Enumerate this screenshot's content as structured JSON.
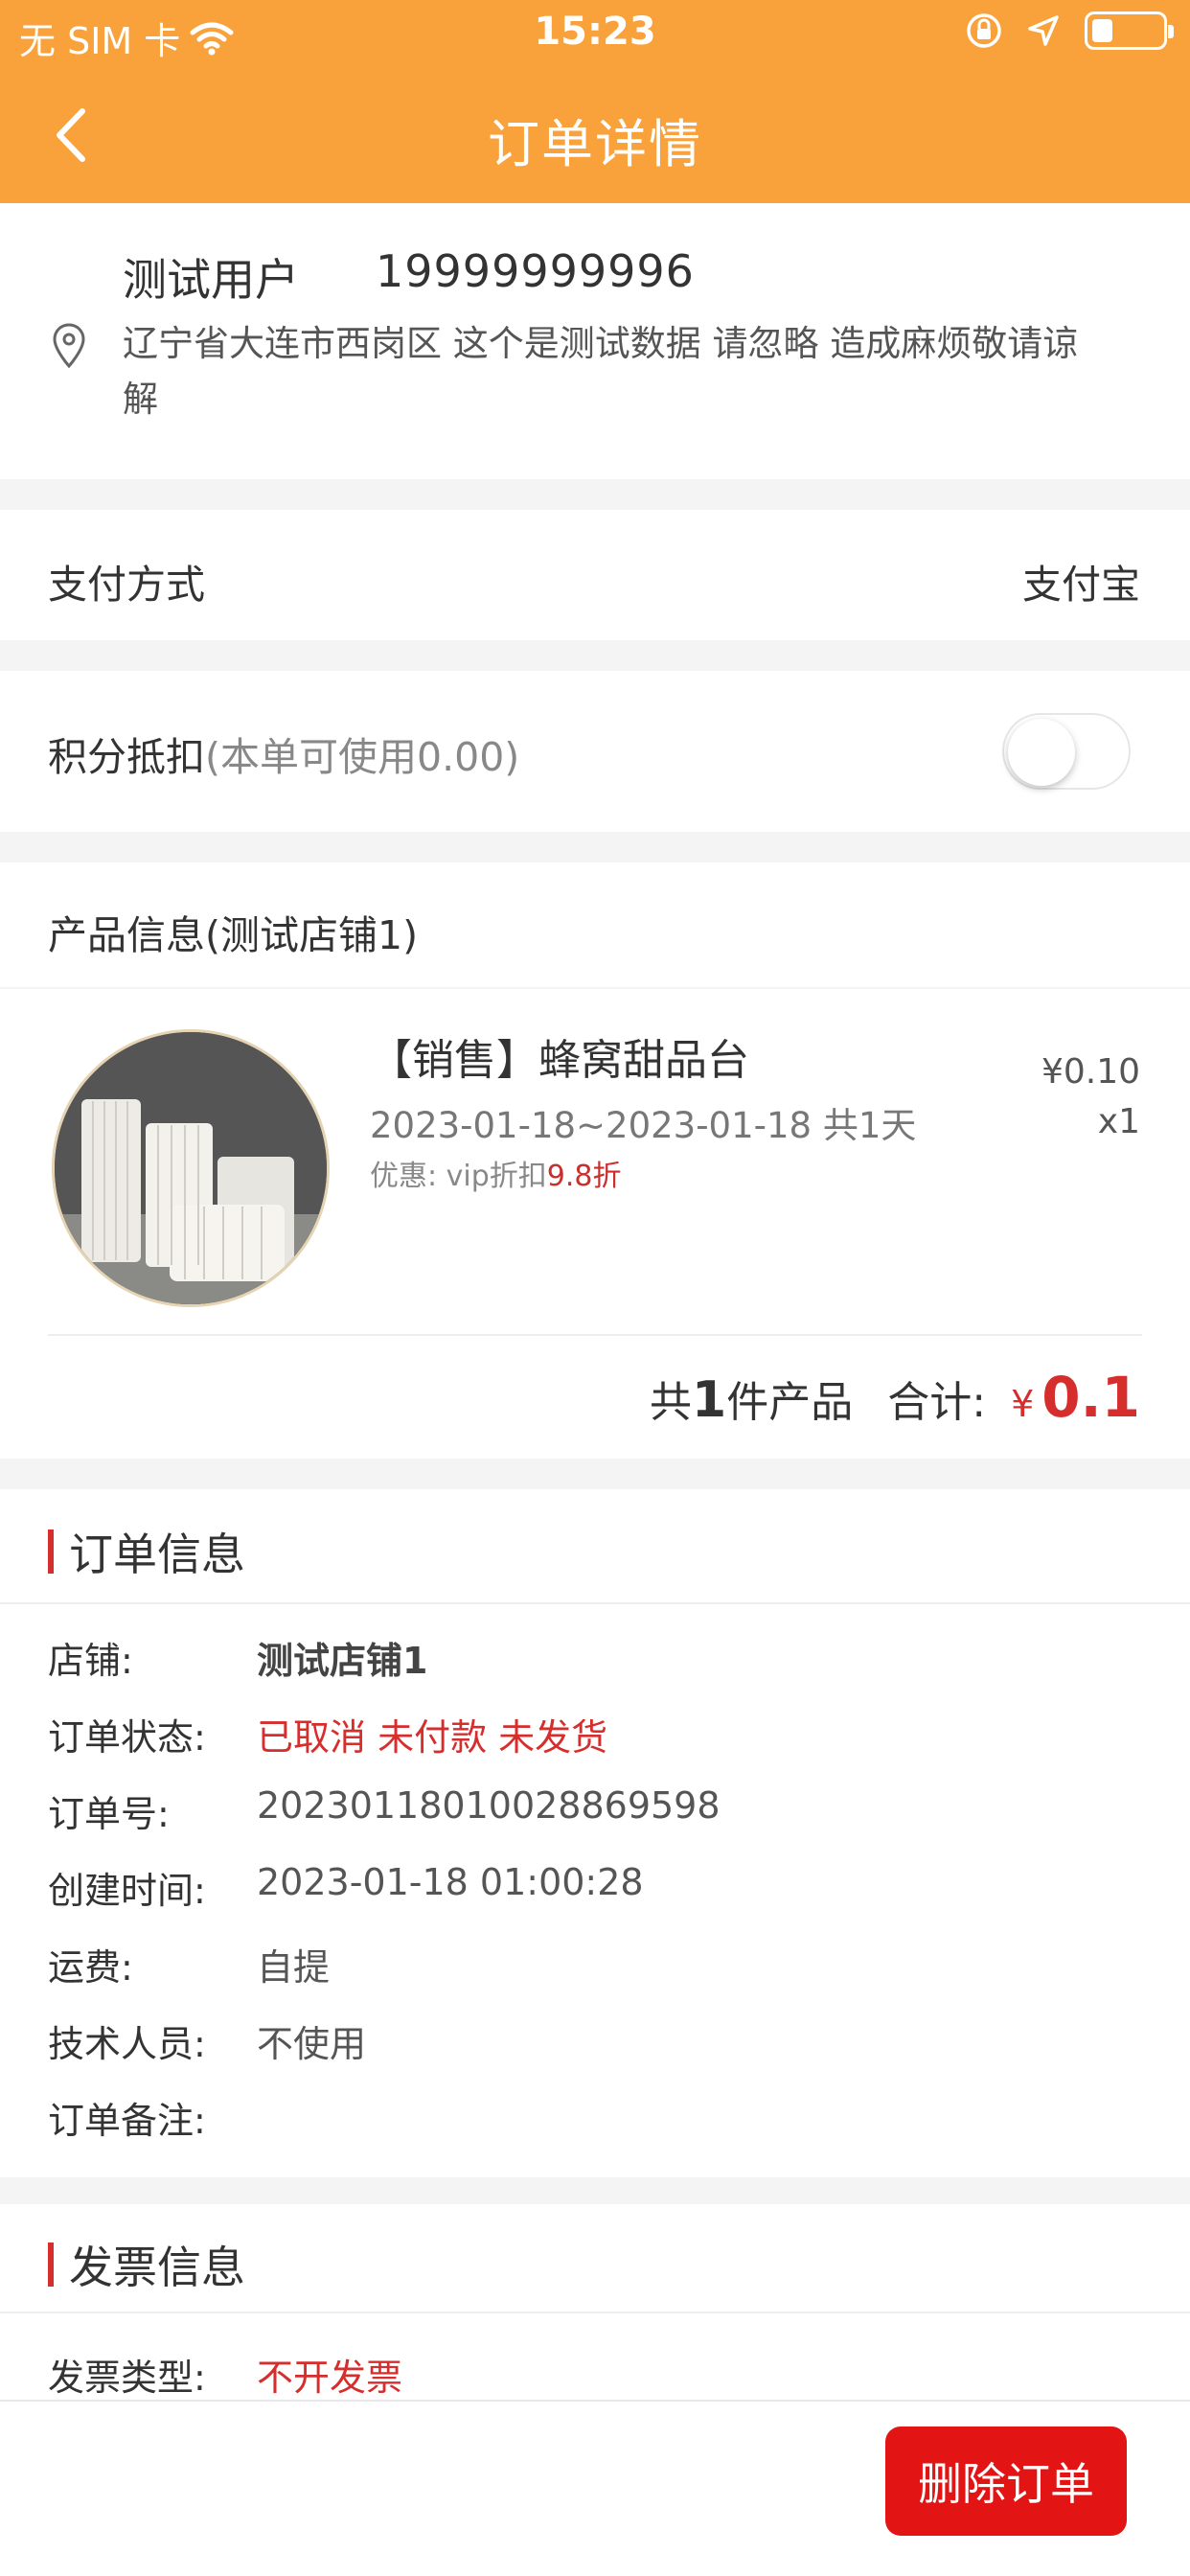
{
  "status_bar": {
    "carrier": "无 SIM 卡",
    "time": "15:23",
    "icons": [
      "wifi-icon",
      "orientation-lock-icon",
      "location-arrow-icon",
      "battery-icon"
    ],
    "battery_level": 0.3
  },
  "nav": {
    "title": "订单详情",
    "back_icon": "chevron-left-icon"
  },
  "address": {
    "name": "测试用户",
    "phone": "19999999996",
    "line": "辽宁省大连市西岗区 这个是测试数据 请忽略 造成麻烦敬请谅解"
  },
  "payment": {
    "label": "支付方式",
    "value": "支付宝"
  },
  "points": {
    "label": "积分抵扣",
    "hint": "(本单可使用0.00)",
    "enabled": false
  },
  "product_section": {
    "title": "产品信息(测试店铺1)",
    "product": {
      "title": "【销售】蜂窝甜品台",
      "date_range": "2023-01-18~2023-01-18 共1天",
      "discount_label": "优惠: vip折扣",
      "discount_value": "9.8折",
      "price": "¥0.10",
      "quantity": "x1"
    },
    "total": {
      "prefix": "共",
      "count": "1",
      "suffix": "件产品",
      "sum_label": "合计:",
      "currency": "¥",
      "amount": "0.1"
    }
  },
  "order_info": {
    "title": "订单信息",
    "rows": [
      {
        "label": "店铺:",
        "value": "测试店铺1"
      },
      {
        "label": "订单状态:",
        "value": "已取消 未付款 未发货"
      },
      {
        "label": "订单号:",
        "value": "20230118010028869598"
      },
      {
        "label": "创建时间:",
        "value": "2023-01-18 01:00:28"
      },
      {
        "label": "运费:",
        "value": "自提"
      },
      {
        "label": "技术人员:",
        "value": "不使用"
      },
      {
        "label": "订单备注:",
        "value": ""
      }
    ]
  },
  "invoice": {
    "title": "发票信息",
    "type_label": "发票类型:",
    "type_value": "不开发票"
  },
  "actions": {
    "delete_label": "删除订单"
  },
  "colors": {
    "header": "#f9a23b",
    "accent_red": "#d62d2d",
    "button_red": "#e21414"
  }
}
